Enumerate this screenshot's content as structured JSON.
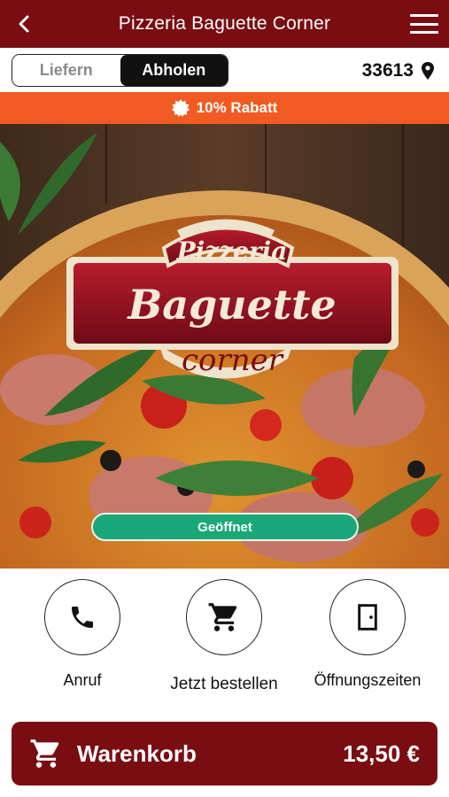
{
  "header": {
    "title": "Pizzeria Baguette Corner",
    "back_icon": "chevron-left-icon",
    "menu_icon": "hamburger-menu-icon",
    "background_color": "#7a0d12"
  },
  "mode_toggle": {
    "options": [
      {
        "label": "Liefern",
        "selected": false
      },
      {
        "label": "Abholen",
        "selected": true
      }
    ]
  },
  "location": {
    "zip": "33613",
    "icon": "map-pin-icon"
  },
  "promo": {
    "text": "10% Rabatt",
    "icon": "badge-icon",
    "color": "#f15a22"
  },
  "hero": {
    "logo": {
      "line1": "Pizzeria",
      "line2": "Baguette",
      "line3": "corner"
    },
    "status": "Geöffnet",
    "status_color": "#1aa87a"
  },
  "actions": [
    {
      "label": "Anruf",
      "icon": "phone-icon"
    },
    {
      "label": "Jetzt bestellen",
      "icon": "shopping-cart-icon"
    },
    {
      "label": "Öffnungszeiten",
      "icon": "door-icon"
    }
  ],
  "cart": {
    "label": "Warenkorb",
    "total": "13,50 €",
    "icon": "shopping-cart-icon"
  }
}
